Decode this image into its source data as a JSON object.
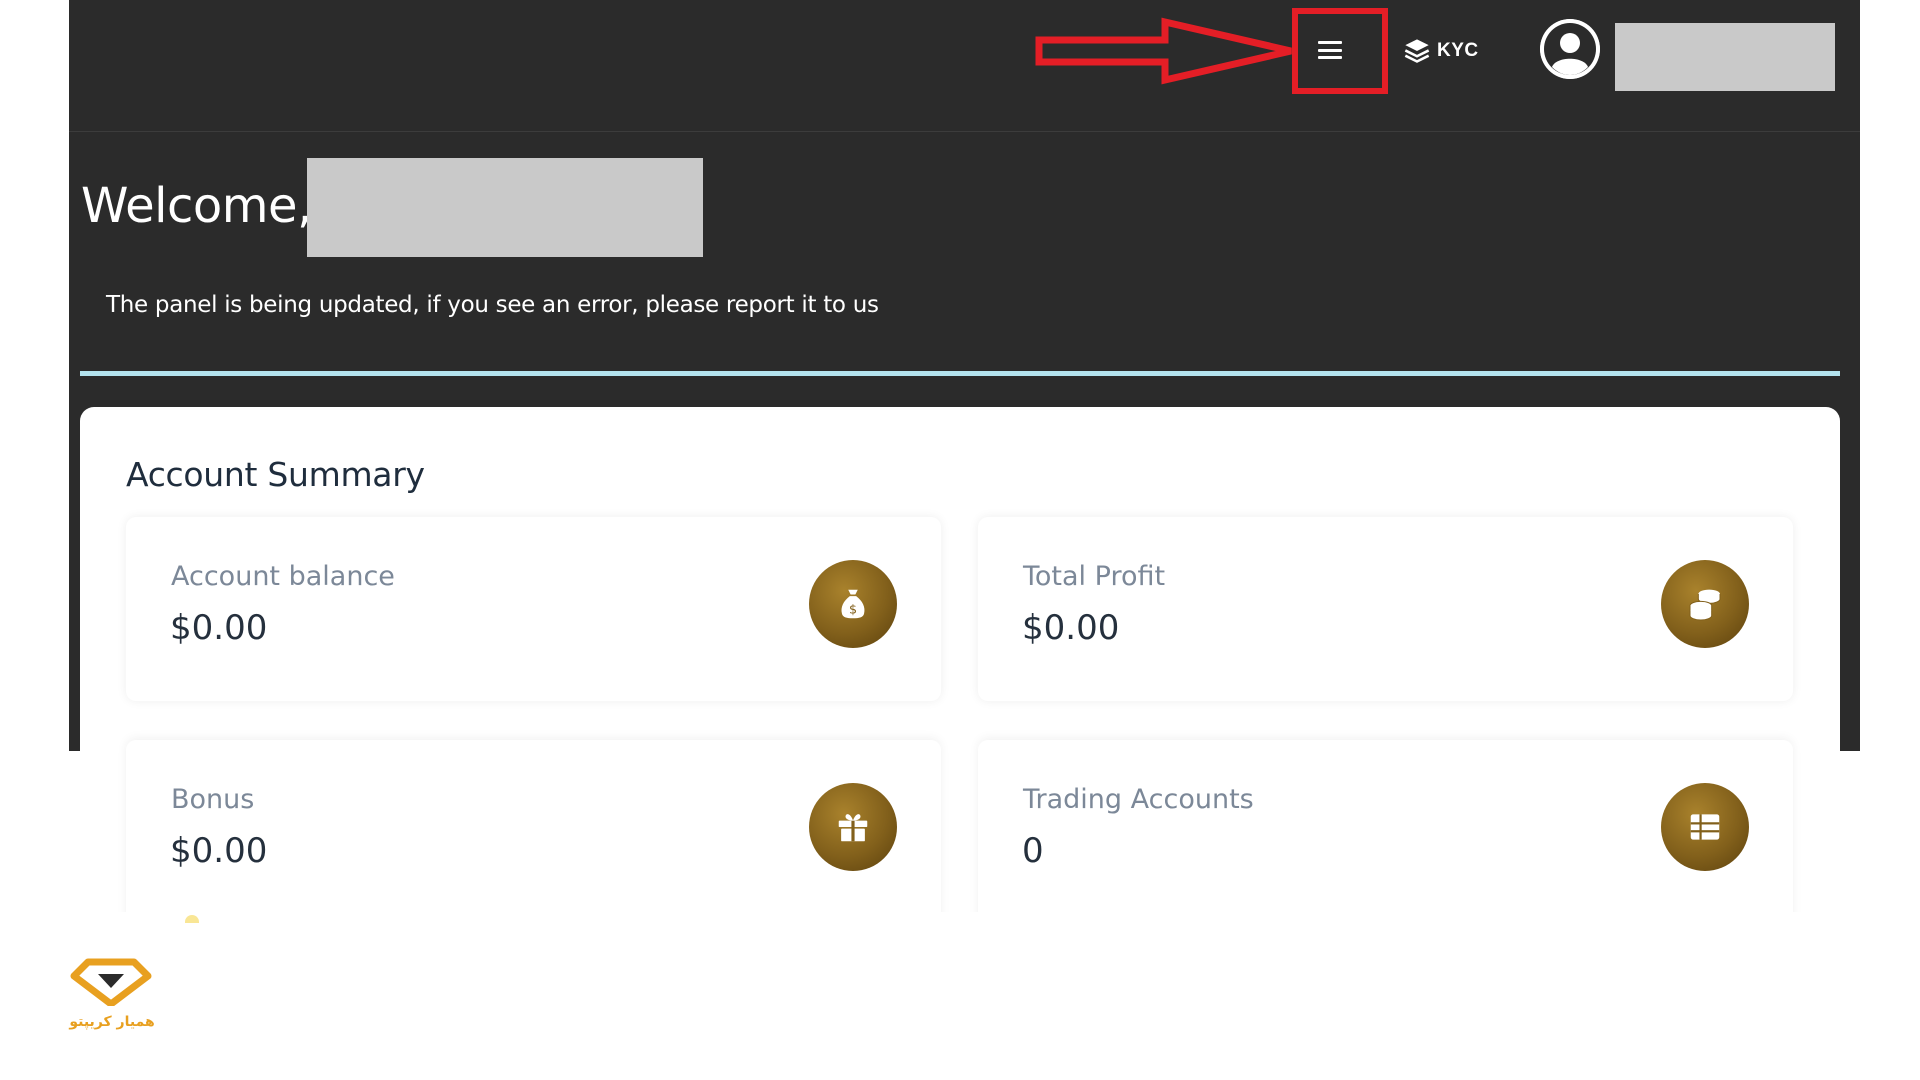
{
  "header": {
    "kyc_label": "KYC",
    "user_name": ""
  },
  "welcome": {
    "greeting": "Welcome,",
    "user_name": "",
    "notice": "The panel is being updated, if you see an error, please report it to us"
  },
  "summary": {
    "title": "Account Summary",
    "stats": [
      {
        "label": "Account balance",
        "value": "$0.00",
        "icon": "money-bag-icon"
      },
      {
        "label": "Total Profit",
        "value": "$0.00",
        "icon": "coins-icon"
      },
      {
        "label": "Bonus",
        "value": "$0.00",
        "icon": "gift-icon"
      },
      {
        "label": "Trading Accounts",
        "value": "0",
        "icon": "table-list-icon"
      }
    ]
  },
  "watermark": {
    "brand_text": "همیار کریپتو"
  },
  "colors": {
    "frame_bg": "#2b2b2b",
    "accent_line": "#b4e3ee",
    "icon_gold": "#82601b",
    "annotation_red": "#e41e26",
    "brand_orange": "#e8a020"
  }
}
